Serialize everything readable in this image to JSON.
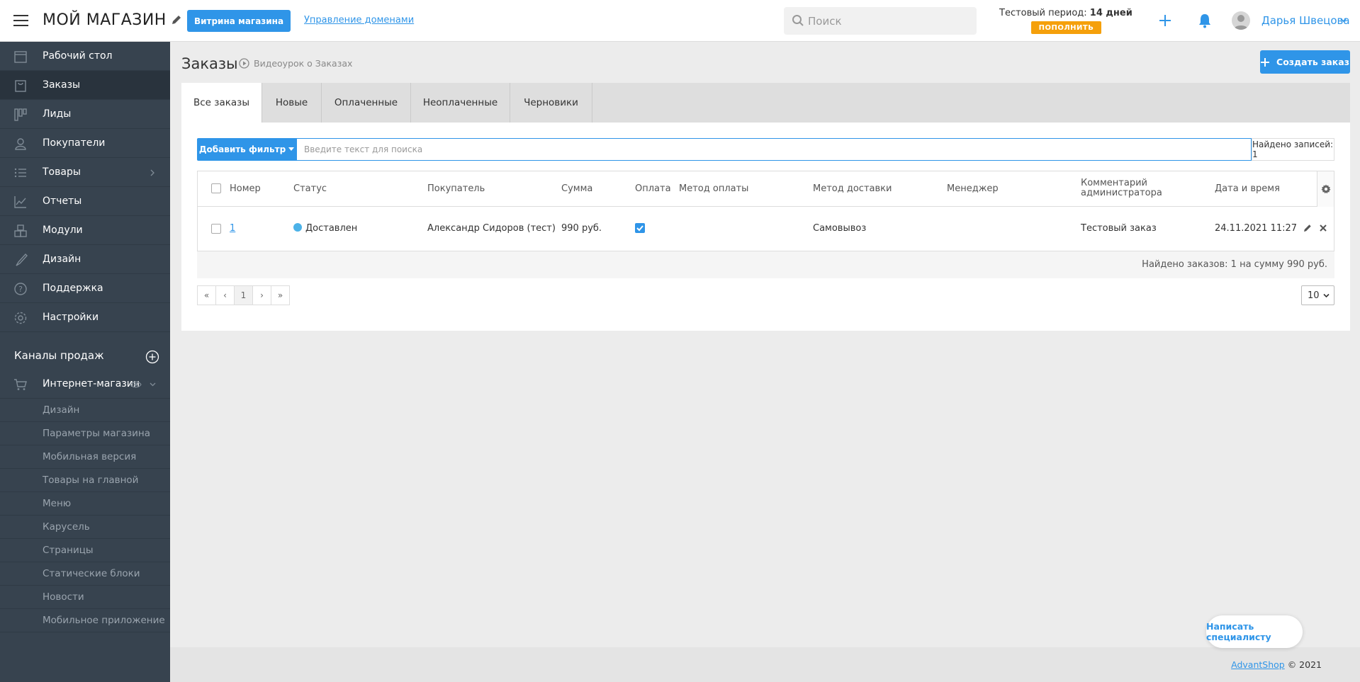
{
  "header": {
    "logo": "МОЙ МАГАЗИН",
    "storefront_button": "Витрина магазина",
    "domains_link": "Управление доменами",
    "search_placeholder": "Поиск",
    "trial_label": "Тестовый период:",
    "trial_days": "14 дней",
    "topup_button": "ПОПОЛНИТЬ",
    "user_name": "Дарья Швецова"
  },
  "sidebar": {
    "items": [
      {
        "label": "Рабочий стол",
        "icon": "calendar-icon"
      },
      {
        "label": "Заказы",
        "icon": "bag-icon",
        "active": true
      },
      {
        "label": "Лиды",
        "icon": "kanban-icon"
      },
      {
        "label": "Покупатели",
        "icon": "user-icon"
      },
      {
        "label": "Товары",
        "icon": "list-icon",
        "has_children": true
      },
      {
        "label": "Отчеты",
        "icon": "chart-icon"
      },
      {
        "label": "Модули",
        "icon": "cubes-icon"
      },
      {
        "label": "Дизайн",
        "icon": "brush-icon"
      },
      {
        "label": "Поддержка",
        "icon": "help-icon"
      },
      {
        "label": "Настройки",
        "icon": "gear-icon"
      }
    ],
    "channels_title": "Каналы продаж",
    "shop": {
      "label": "Интернет-магазин",
      "icon": "cart-icon"
    },
    "shop_subitems": [
      "Дизайн",
      "Параметры магазина",
      "Мобильная версия",
      "Товары на главной",
      "Меню",
      "Карусель",
      "Страницы",
      "Статические блоки",
      "Новости",
      "Мобильное приложение"
    ]
  },
  "main": {
    "title": "Заказы",
    "video_link": "Видеоурок о Заказах",
    "create_button": "Создать заказ",
    "tabs": [
      {
        "label": "Все заказы",
        "active": true
      },
      {
        "label": "Новые"
      },
      {
        "label": "Оплаченные"
      },
      {
        "label": "Неоплаченные"
      },
      {
        "label": "Черновики"
      }
    ],
    "filter_button": "Добавить фильтр",
    "filter_placeholder": "Введите текст для поиска",
    "records_found": "Найдено записей: 1",
    "columns": [
      "Номер",
      "Статус",
      "Покупатель",
      "Сумма",
      "Оплата",
      "Метод оплаты",
      "Метод доставки",
      "Менеджер",
      "Комментарий администратора",
      "Дата и время"
    ],
    "rows": [
      {
        "number": "1",
        "status": "Доставлен",
        "status_color": "#4cb2e8",
        "customer": "Александр Сидоров (тест)",
        "sum": "990 руб.",
        "paid": true,
        "payment_method": "",
        "delivery_method": "Самовывоз",
        "manager": "",
        "comment": "Тестовый заказ",
        "datetime": "24.11.2021 11:27"
      }
    ],
    "summary": "Найдено заказов: 1 на сумму 990 руб.",
    "pager": [
      "«",
      "‹",
      "1",
      "›",
      "»"
    ],
    "page_size": "10"
  },
  "footer": {
    "brand": "AdvantShop",
    "copyright": "© 2021"
  },
  "chat_button": "Написать специалисту",
  "colors": {
    "accent": "#2f95e8",
    "sidebar": "#37434f",
    "topup": "#f5a00b"
  }
}
